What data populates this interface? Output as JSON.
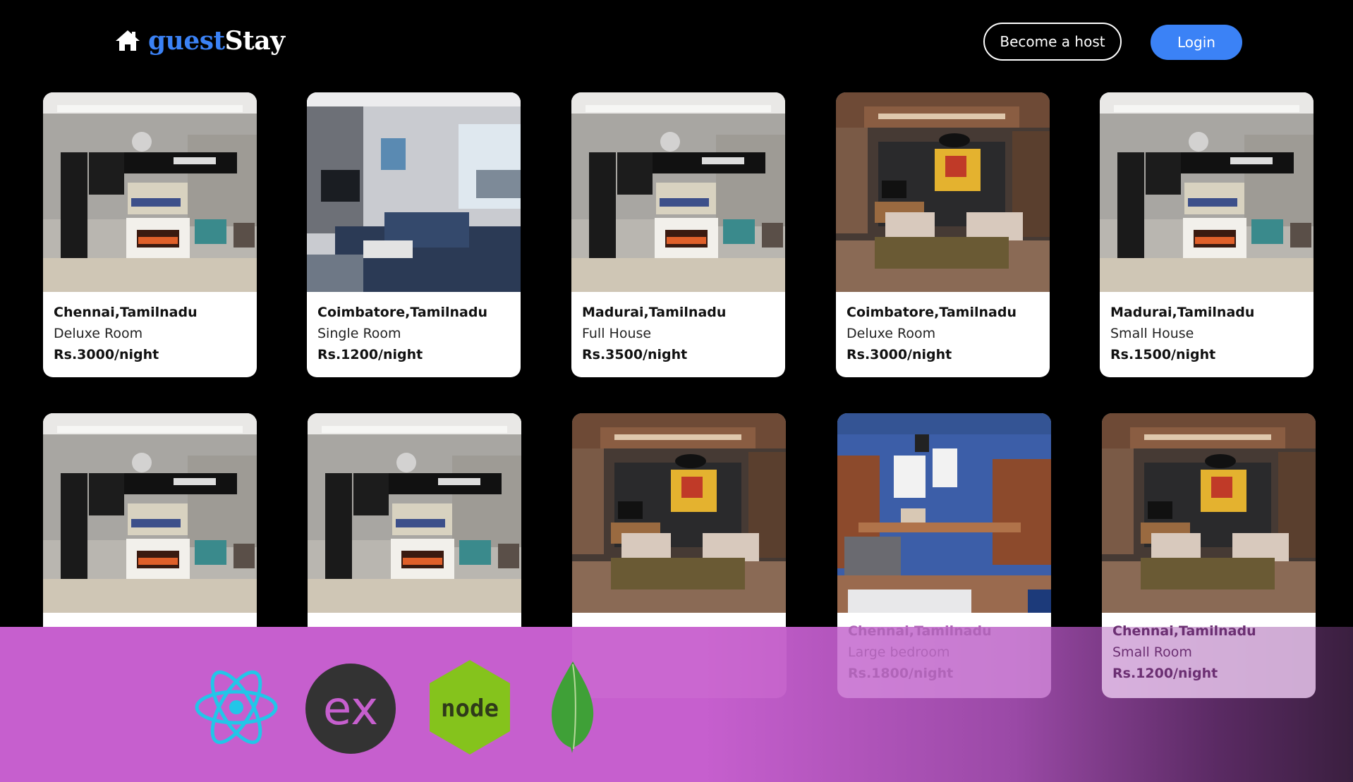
{
  "header": {
    "brand_first": "guest",
    "brand_second": "Stay",
    "host_button": "Become a host",
    "login_button": "Login"
  },
  "listings": [
    {
      "location": "Chennai,Tamilnadu",
      "type": "Deluxe Room",
      "price": "Rs.3000/night",
      "image": "grey-fireplace-room"
    },
    {
      "location": "Coimbatore,Tamilnadu",
      "type": "Single Room",
      "price": "Rs.1200/night",
      "image": "blue-sofa-living-room"
    },
    {
      "location": "Madurai,Tamilnadu",
      "type": "Full House",
      "price": "Rs.3500/night",
      "image": "grey-fireplace-room"
    },
    {
      "location": "Coimbatore,Tamilnadu",
      "type": "Deluxe Room",
      "price": "Rs.3000/night",
      "image": "wood-lounge-room"
    },
    {
      "location": "Madurai,Tamilnadu",
      "type": "Small House",
      "price": "Rs.1500/night",
      "image": "grey-fireplace-room"
    },
    {
      "location": "",
      "type": "",
      "price": "",
      "image": "grey-fireplace-room"
    },
    {
      "location": "",
      "type": "",
      "price": "",
      "image": "grey-fireplace-room"
    },
    {
      "location": "",
      "type": "",
      "price": "",
      "image": "wood-lounge-room"
    },
    {
      "location": "Chennai,Tamilnadu",
      "type": "Large bedroom",
      "price": "Rs.1800/night",
      "image": "blue-study-room"
    },
    {
      "location": "Chennai,Tamilnadu",
      "type": "Small Room",
      "price": "Rs.1200/night",
      "image": "wood-lounge-room"
    }
  ],
  "tech_icons": [
    "react-icon",
    "express-icon",
    "nodejs-icon",
    "mongodb-icon"
  ],
  "tech_labels": {
    "express": "ex",
    "node": "node"
  },
  "colors": {
    "accent": "#3b82f6",
    "banner": "#c65fce",
    "background": "#000000"
  }
}
